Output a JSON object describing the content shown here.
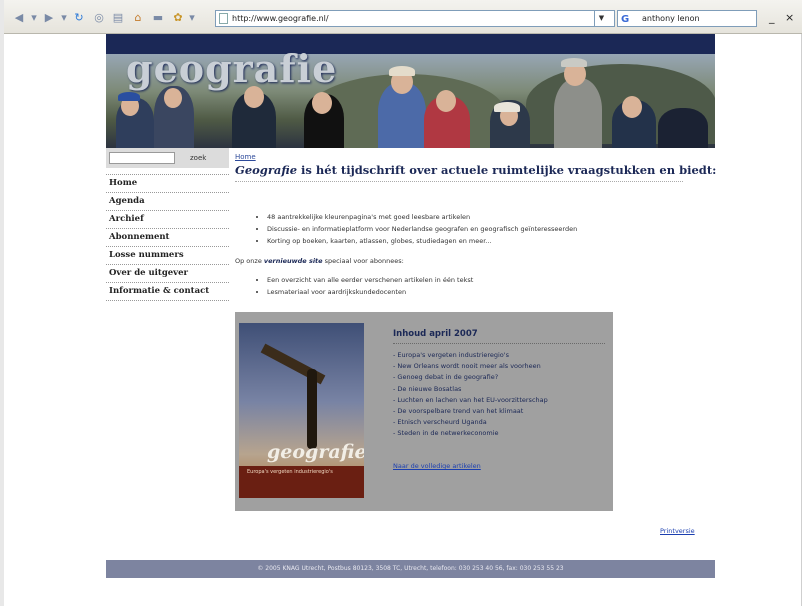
{
  "browser": {
    "address": "http://www.geografie.nl/",
    "search_text": "anthony lenon",
    "search_engine_glyph": "G",
    "window_controls": [
      "_",
      "×"
    ]
  },
  "site": {
    "logo": "geografie",
    "search": {
      "button": "zoek"
    },
    "nav": [
      "Home",
      "Agenda",
      "Archief",
      "Abonnement",
      "Losse nummers",
      "Over de uitgever",
      "Informatie & contact"
    ]
  },
  "main": {
    "breadcrumb": "Home",
    "headline_brand": "Geografie",
    "headline_rest": " is hét tijdschrift over actuele ruimtelijke vraagstukken en biedt:",
    "benefits": [
      "48 aantrekkelijke kleurenpagina's met goed leesbare artikelen",
      "Discussie- en informatieplatform voor Nederlandse geografen en geografisch geïnteresseerden",
      "Korting op boeken, kaarten, atlassen, globes, studiedagen en meer..."
    ],
    "intro_prefix": "Op onze ",
    "intro_link": "vernieuwde site",
    "intro_suffix": " speciaal voor abonnees:",
    "subscriber_items": [
      "Een overzicht van alle eerder verschenen artikelen in één tekst",
      "Lesmateriaal voor aardrijkskundedocenten"
    ]
  },
  "issue": {
    "title": "Inhoud april 2007",
    "cover_title": "geografie",
    "cover_caption": "Europa's vergeten industrieregio's",
    "articles": [
      "- Europa's vergeten industrieregio's",
      "- New Orleans wordt nooit meer als voorheen",
      "- Genoeg debat in de geografie?",
      "- De nieuwe Bosatlas",
      "- Luchten en lachen van het EU-voorzitterschap",
      "- De voorspelbare trend van het klimaat",
      "- Etnisch verscheurd Uganda",
      "- Steden in de netwerkeconomie"
    ],
    "full_link": "Naar de volledige artikelen"
  },
  "print_link": "Printversie",
  "footer": "© 2005 KNAG Utrecht, Postbus 80123, 3508 TC, Utrecht, telefoon: 030 253 40 56, fax: 030 253 55 23"
}
